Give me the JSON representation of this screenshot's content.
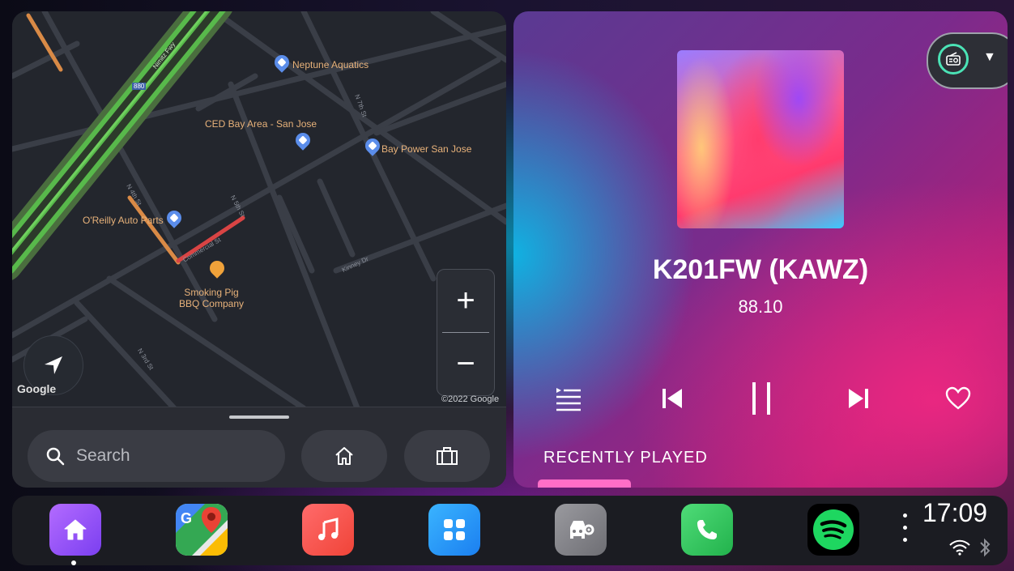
{
  "map": {
    "places": {
      "neptune": "Neptune Aquatics",
      "ced": "CED Bay Area - San Jose",
      "bay_power": "Bay Power San Jose",
      "oreilly": "O'Reilly Auto Parts",
      "smoking_pig_line1": "Smoking Pig",
      "smoking_pig_line2": "BBQ Company"
    },
    "streets": {
      "n7th": "N 7th St",
      "n4th": "N 4th St",
      "n5th": "N 5th St",
      "commercial": "Commercial St",
      "kinney": "Kinney Dr",
      "n3rd": "N 3rd St",
      "nimitz": "Nimitz Fwy",
      "i880": "880"
    },
    "zoom_in": "+",
    "zoom_out": "−",
    "google": "Google",
    "copyright": "©2022 Google",
    "search_placeholder": "Search"
  },
  "player": {
    "station": "K201FW (KAWZ)",
    "frequency": "88.10",
    "recently_played": "RECENTLY PLAYED"
  },
  "dock": {
    "apps": [
      "home",
      "google-maps",
      "music",
      "app-grid",
      "car-settings",
      "phone",
      "spotify"
    ],
    "time": "17:09"
  },
  "colors": {
    "map_bg": "#23262d",
    "traffic_green": "#58b94b",
    "traffic_orange": "#d98a46",
    "traffic_red": "#d94444",
    "accent_ring": "#4be3b6",
    "recent_bar": "#ff6ec7"
  }
}
